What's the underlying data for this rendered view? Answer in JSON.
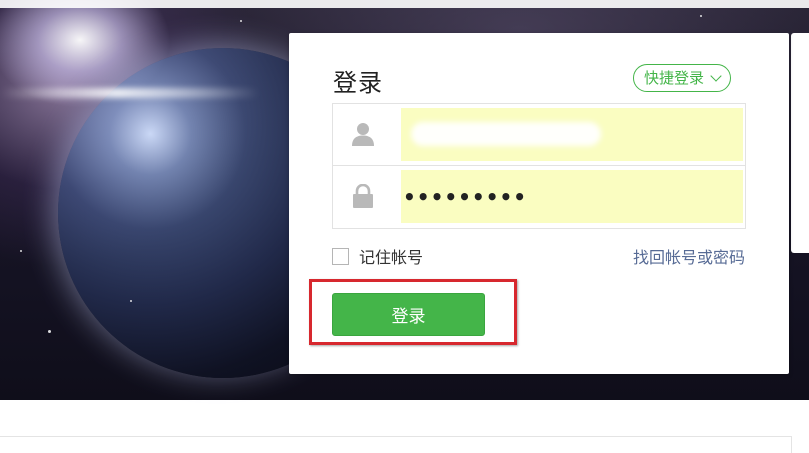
{
  "login": {
    "title": "登录",
    "quick_login_label": "快捷登录",
    "username": {
      "value": "",
      "icon": "user-icon"
    },
    "password": {
      "value": "•••••••••",
      "icon": "lock-icon"
    },
    "remember_label": "记住帐号",
    "forgot_label": "找回帐号或密码",
    "submit_label": "登录"
  },
  "colors": {
    "accent": "#44b549",
    "link": "#576b95",
    "autofill": "#fafdc1",
    "highlight": "#d7282e"
  }
}
